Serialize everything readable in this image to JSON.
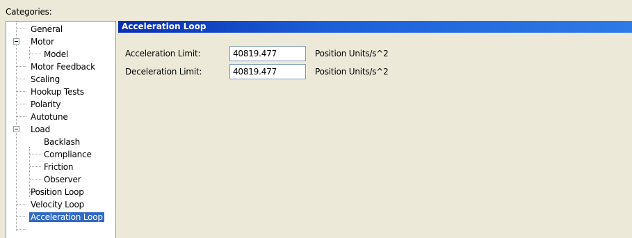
{
  "categories_label": "Categories:",
  "tree": {
    "items": [
      {
        "label": "General"
      },
      {
        "label": "Motor"
      },
      {
        "label": "Model"
      },
      {
        "label": "Motor Feedback"
      },
      {
        "label": "Scaling"
      },
      {
        "label": "Hookup Tests"
      },
      {
        "label": "Polarity"
      },
      {
        "label": "Autotune"
      },
      {
        "label": "Load"
      },
      {
        "label": "Backlash"
      },
      {
        "label": "Compliance"
      },
      {
        "label": "Friction"
      },
      {
        "label": "Observer"
      },
      {
        "label": "Position Loop"
      },
      {
        "label": "Velocity Loop"
      },
      {
        "label": "Acceleration Loop"
      }
    ],
    "selected": "Acceleration Loop"
  },
  "panel": {
    "title": "Acceleration Loop",
    "fields": [
      {
        "label": "Acceleration Limit:",
        "value": "40819.477",
        "unit": "Position Units/s^2"
      },
      {
        "label": "Deceleration Limit:",
        "value": "40819.477",
        "unit": "Position Units/s^2"
      }
    ]
  },
  "colors": {
    "selection": "#316ac5",
    "header_gradient_start": "#0a2eb0",
    "header_gradient_end": "#2e7ae8",
    "background": "#ece9d8"
  }
}
